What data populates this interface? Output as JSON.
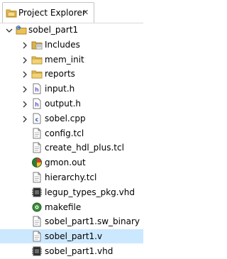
{
  "view": {
    "tab_label": "Project Explorer",
    "tab_icon": "project-explorer-icon",
    "close_icon": "close-icon"
  },
  "tree": [
    {
      "label": "sobel_part1",
      "icon": "project-folder-icon",
      "twisty": "expanded",
      "level": 0
    },
    {
      "label": "Includes",
      "icon": "includes-folder-icon",
      "twisty": "collapsed",
      "level": 1
    },
    {
      "label": "mem_init",
      "icon": "folder-icon",
      "twisty": "collapsed",
      "level": 1
    },
    {
      "label": "reports",
      "icon": "folder-icon",
      "twisty": "collapsed",
      "level": 1
    },
    {
      "label": "input.h",
      "icon": "header-file-icon",
      "twisty": "collapsed",
      "level": 1
    },
    {
      "label": "output.h",
      "icon": "header-file-icon",
      "twisty": "collapsed",
      "level": 1
    },
    {
      "label": "sobel.cpp",
      "icon": "cpp-file-icon",
      "twisty": "collapsed",
      "level": 1
    },
    {
      "label": "config.tcl",
      "icon": "file-icon",
      "twisty": "none",
      "level": 1
    },
    {
      "label": "create_hdl_plus.tcl",
      "icon": "file-icon",
      "twisty": "none",
      "level": 1
    },
    {
      "label": "gmon.out",
      "icon": "gprof-file-icon",
      "twisty": "none",
      "level": 1
    },
    {
      "label": "hierarchy.tcl",
      "icon": "file-icon",
      "twisty": "none",
      "level": 1
    },
    {
      "label": "legup_types_pkg.vhd",
      "icon": "vhdl-file-icon",
      "twisty": "none",
      "level": 1
    },
    {
      "label": "makefile",
      "icon": "makefile-icon",
      "twisty": "none",
      "level": 1
    },
    {
      "label": "sobel_part1.sw_binary",
      "icon": "file-icon",
      "twisty": "none",
      "level": 1
    },
    {
      "label": "sobel_part1.v",
      "icon": "file-icon",
      "twisty": "none",
      "level": 1,
      "selected": true
    },
    {
      "label": "sobel_part1.vhd",
      "icon": "vhdl-file-icon",
      "twisty": "none",
      "level": 1
    }
  ]
}
